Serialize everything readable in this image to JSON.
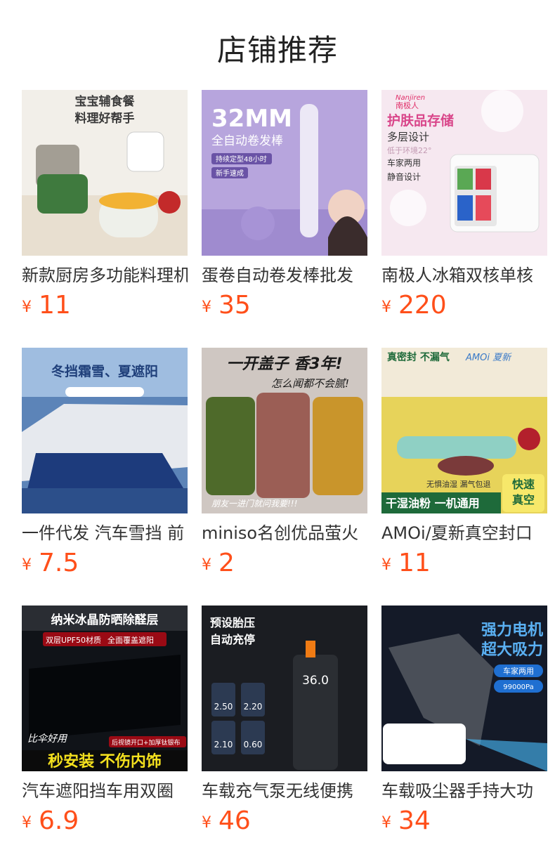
{
  "section_title": "店铺推荐",
  "currency_symbol": "¥",
  "products": [
    {
      "name": "新款厨房多功能料理机",
      "price": "11",
      "image_text": [
        "宝宝辅食餐",
        "料理好帮手"
      ]
    },
    {
      "name": "蛋卷自动卷发棒批发",
      "price": "35",
      "image_text": [
        "32MM",
        "全自动卷发棒",
        "持续定型48小时",
        "新手速成"
      ]
    },
    {
      "name": "南极人冰箱双核单核",
      "price": "220",
      "image_text": [
        "Nanjiren",
        "南极人",
        "护肤品存储",
        "多层设计",
        "低于环境22°",
        "车家两用",
        "静音设计"
      ]
    },
    {
      "name": "一件代发 汽车雪挡 前",
      "price": "7.5",
      "image_text": [
        "冬挡霜雪、夏遮阳"
      ]
    },
    {
      "name": "miniso名创优品萤火",
      "price": "2",
      "image_text": [
        "一开盖子 香3年!",
        "怎么闻都不会腻!",
        "朋友一进门就问我要!!!"
      ]
    },
    {
      "name": "AMOi/夏新真空封口",
      "price": "11",
      "image_text": [
        "真密封 不漏气",
        "AMOi 夏新",
        "无惧油湿 漏气包退",
        "干湿油粉 一机通用",
        "快速",
        "真空"
      ]
    },
    {
      "name": "汽车遮阳挡车用双圈",
      "price": "6.9",
      "image_text": [
        "纳米冰晶防晒除醛层",
        "双层UPF50材质",
        "全面覆盖遮阳",
        "比伞好用",
        "后视镜开口+加厚钛银布",
        "秒安装 不伤内饰"
      ]
    },
    {
      "name": "车载充气泵无线便携",
      "price": "46",
      "image_text": [
        "预设胎压",
        "自动充停",
        "36.0",
        "2.50",
        "2.20",
        "2.10",
        "0.60"
      ]
    },
    {
      "name": "车载吸尘器手持大功",
      "price": "34",
      "image_text": [
        "强力电机",
        "超大吸力",
        "车家两用",
        "99000Pa"
      ]
    }
  ],
  "colors": {
    "price": "#ff4f1a",
    "title": "#222222",
    "name": "#333333"
  }
}
